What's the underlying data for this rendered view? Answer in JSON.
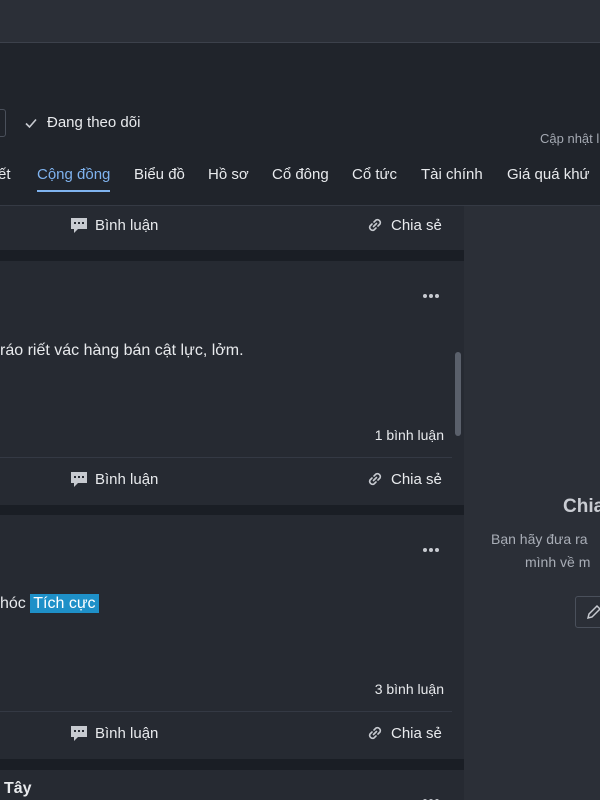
{
  "header": {
    "follow_label": "Đang theo dõi",
    "updated_label": "Cập nhật l"
  },
  "tabs": [
    {
      "label": "ết"
    },
    {
      "label": "Cộng đồng",
      "active": true
    },
    {
      "label": "Biểu đồ"
    },
    {
      "label": "Hồ sơ"
    },
    {
      "label": "Cổ đông"
    },
    {
      "label": "Cổ tức"
    },
    {
      "label": "Tài chính"
    },
    {
      "label": "Giá quá khứ"
    }
  ],
  "actions": {
    "comment": "Bình luận",
    "share": "Chia sẻ"
  },
  "posts": [
    {
      "text": "ráo riết vác hàng bán cật lực, lởm.",
      "comments": "1 bình luận"
    },
    {
      "text": "hóc",
      "tag": "Tích cực",
      "comments": "3 bình luận"
    },
    {
      "author": "Tây"
    }
  ],
  "right_panel": {
    "title": "Chia",
    "line1": "Bạn hãy đưa ra",
    "line2": "mình về m"
  },
  "colors": {
    "accent": "#7fb3ef",
    "tag": "#1e90c8",
    "background": "#1a1e25"
  }
}
